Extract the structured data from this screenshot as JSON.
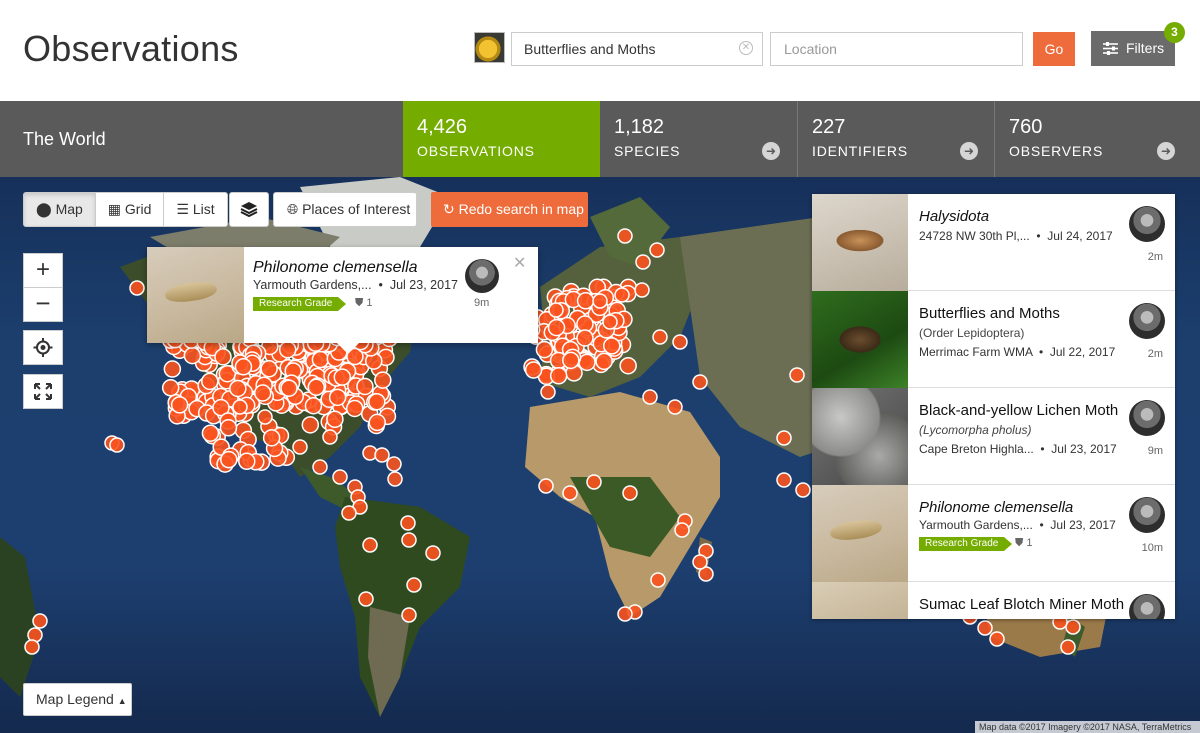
{
  "header": {
    "title": "Observations",
    "taxon_value": "Butterflies and Moths",
    "location_placeholder": "Location",
    "go_label": "Go",
    "filters_label": "Filters",
    "filters_badge": "3"
  },
  "stats": {
    "place": "The World",
    "observations": {
      "count": "4,426",
      "label": "OBSERVATIONS"
    },
    "species": {
      "count": "1,182",
      "label": "SPECIES"
    },
    "identifiers": {
      "count": "227",
      "label": "IDENTIFIERS"
    },
    "observers": {
      "count": "760",
      "label": "OBSERVERS"
    }
  },
  "map": {
    "view_tabs": [
      "Map",
      "Grid",
      "List"
    ],
    "active_view": "Map",
    "places_label": "Places of Interest",
    "redo_label": "Redo search in map",
    "legend_label": "Map Legend",
    "attribution": "Map data ©2017 Imagery ©2017 NASA, TerraMetrics",
    "marker_color": "#f9531e"
  },
  "popup": {
    "title": "Philonome clemensella",
    "place": "Yarmouth Gardens,...",
    "date": "Jul 23, 2017",
    "quality": "Research Grade",
    "ids": "1",
    "time": "9m"
  },
  "observations": [
    {
      "title": "Halysidota",
      "italic": true,
      "subtitle": "",
      "place": "24728 NW 30th Pl,...",
      "date": "Jul 24, 2017",
      "quality": "",
      "ids": "",
      "time": "2m"
    },
    {
      "title": "Butterflies and Moths",
      "italic": false,
      "subtitle": "(Order Lepidoptera)",
      "place": "Merrimac Farm WMA",
      "date": "Jul 22, 2017",
      "quality": "",
      "ids": "",
      "time": "2m"
    },
    {
      "title": "Black-and-yellow Lichen Moth",
      "italic": false,
      "subtitle": "(Lycomorpha pholus)",
      "place": "Cape Breton Highla...",
      "date": "Jul 23, 2017",
      "quality": "",
      "ids": "",
      "time": "9m"
    },
    {
      "title": "Philonome clemensella",
      "italic": true,
      "subtitle": "",
      "place": "Yarmouth Gardens,...",
      "date": "Jul 23, 2017",
      "quality": "Research Grade",
      "ids": "1",
      "time": "10m"
    },
    {
      "title": "Sumac Leaf Blotch Miner Moth",
      "italic": false,
      "subtitle": "",
      "place": "",
      "date": "",
      "quality": "",
      "ids": "",
      "time": ""
    }
  ],
  "colors": {
    "accent_green": "#74ac00",
    "accent_orange": "#ee6b3b",
    "stats_bg": "#5a5a5a"
  }
}
